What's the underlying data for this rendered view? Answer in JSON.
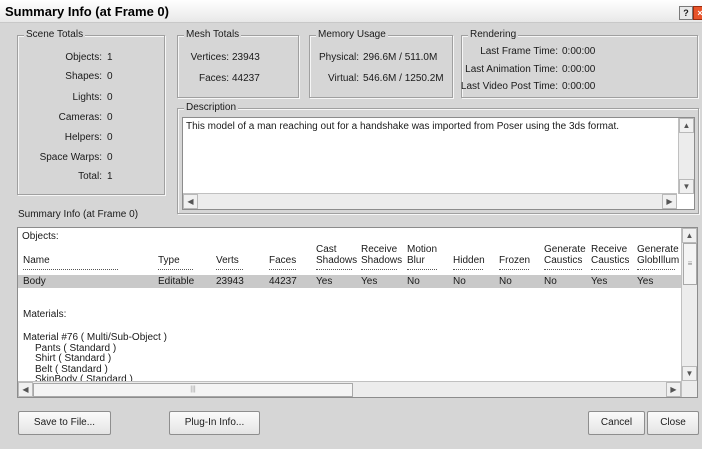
{
  "window": {
    "title": "Summary Info (at Frame 0)",
    "help_glyph": "?",
    "close_glyph": "×"
  },
  "scene_totals": {
    "legend": "Scene Totals",
    "rows": [
      {
        "label": "Objects:",
        "value": "1"
      },
      {
        "label": "Shapes:",
        "value": "0"
      },
      {
        "label": "Lights:",
        "value": "0"
      },
      {
        "label": "Cameras:",
        "value": "0"
      },
      {
        "label": "Helpers:",
        "value": "0"
      },
      {
        "label": "Space Warps:",
        "value": "0"
      },
      {
        "label": "Total:",
        "value": "1"
      }
    ]
  },
  "mesh_totals": {
    "legend": "Mesh Totals",
    "vertices_label": "Vertices:",
    "vertices_value": "23943",
    "faces_label": "Faces:",
    "faces_value": "44237"
  },
  "memory_usage": {
    "legend": "Memory Usage",
    "physical_label": "Physical:",
    "physical_value": "296.6M / 511.0M",
    "virtual_label": "Virtual:",
    "virtual_value": "546.6M / 1250.2M"
  },
  "rendering": {
    "legend": "Rendering",
    "rows": [
      {
        "label": "Last Frame Time:",
        "value": "0:00:00"
      },
      {
        "label": "Last Animation Time:",
        "value": "0:00:00"
      },
      {
        "label": "Last Video Post Time:",
        "value": "0:00:00"
      }
    ]
  },
  "description": {
    "legend": "Description",
    "text": "This model of a man reaching out for a handshake was imported from Poser using the 3ds format."
  },
  "summary_caption": "Summary Info (at Frame 0)",
  "report": {
    "objects_heading": "Objects:",
    "columns": [
      {
        "l1": "",
        "l2": "Name"
      },
      {
        "l1": "",
        "l2": "Type"
      },
      {
        "l1": "",
        "l2": "Verts"
      },
      {
        "l1": "",
        "l2": "Faces"
      },
      {
        "l1": "Cast",
        "l2": "Shadows"
      },
      {
        "l1": "Receive",
        "l2": "Shadows"
      },
      {
        "l1": "Motion",
        "l2": "Blur"
      },
      {
        "l1": "",
        "l2": "Hidden"
      },
      {
        "l1": "",
        "l2": "Frozen"
      },
      {
        "l1": "Generate",
        "l2": "Caustics"
      },
      {
        "l1": "Receive",
        "l2": "Caustics"
      },
      {
        "l1": "Generate",
        "l2": "GlobIllum"
      }
    ],
    "row": [
      "Body",
      "Editable",
      "23943",
      "44237",
      "Yes",
      "Yes",
      "No",
      "No",
      "No",
      "No",
      "Yes",
      "Yes"
    ],
    "materials_heading": "Materials:",
    "materials": [
      "Material #76  ( Multi/Sub-Object )",
      "Pants  ( Standard )",
      "Shirt  ( Standard )",
      "Belt  ( Standard )",
      "SkinBody  ( Standard )"
    ]
  },
  "buttons": {
    "save": "Save to File...",
    "plugin": "Plug-In Info...",
    "cancel": "Cancel",
    "close": "Close"
  },
  "scroll": {
    "up": "▲",
    "down": "▼",
    "left": "◀",
    "right": "▶",
    "grip": "≡",
    "hgrip": "|||"
  }
}
